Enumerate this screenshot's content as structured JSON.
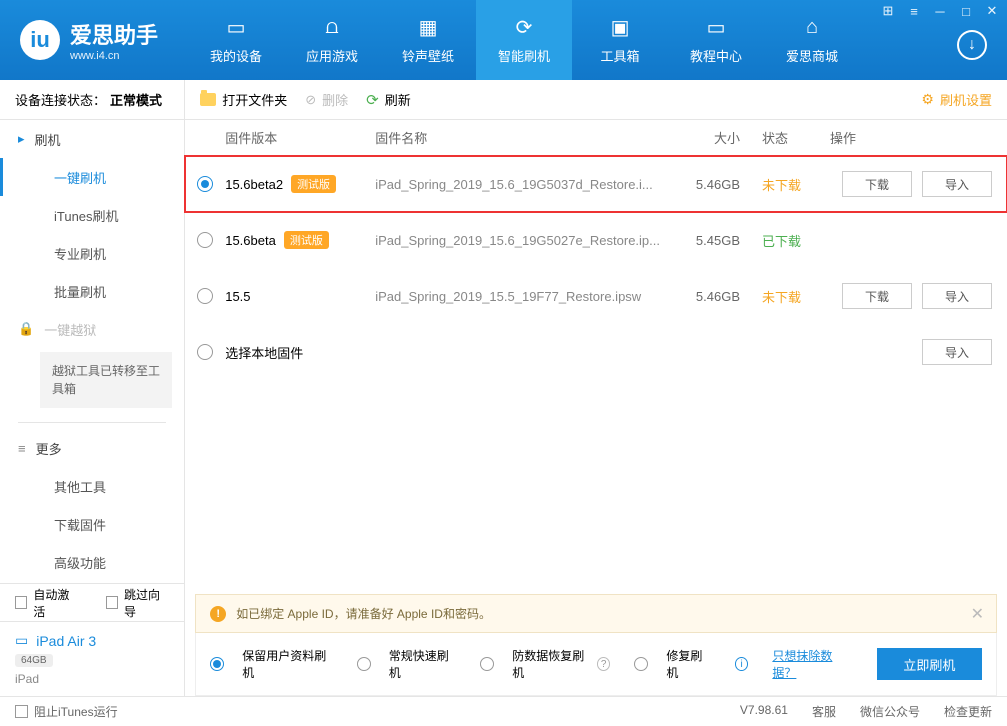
{
  "app": {
    "name": "爱思助手",
    "url": "www.i4.cn"
  },
  "nav": {
    "items": [
      {
        "label": "我的设备"
      },
      {
        "label": "应用游戏"
      },
      {
        "label": "铃声壁纸"
      },
      {
        "label": "智能刷机"
      },
      {
        "label": "工具箱"
      },
      {
        "label": "教程中心"
      },
      {
        "label": "爱思商城"
      }
    ]
  },
  "sidebar": {
    "status_label": "设备连接状态：",
    "status_value": "正常模式",
    "flash_header": "刷机",
    "items": [
      "一键刷机",
      "iTunes刷机",
      "专业刷机",
      "批量刷机"
    ],
    "jailbreak_header": "一键越狱",
    "jailbreak_note": "越狱工具已转移至工具箱",
    "more_header": "更多",
    "more_items": [
      "其他工具",
      "下载固件",
      "高级功能"
    ],
    "auto_activate": "自动激活",
    "skip_guide": "跳过向导",
    "device_name": "iPad Air 3",
    "device_capacity": "64GB",
    "device_type": "iPad"
  },
  "toolbar": {
    "open_folder": "打开文件夹",
    "delete": "删除",
    "refresh": "刷新",
    "settings": "刷机设置"
  },
  "table": {
    "headers": {
      "version": "固件版本",
      "name": "固件名称",
      "size": "大小",
      "status": "状态",
      "op": "操作"
    },
    "rows": [
      {
        "version": "15.6beta2",
        "beta": "测试版",
        "name": "iPad_Spring_2019_15.6_19G5037d_Restore.i...",
        "size": "5.46GB",
        "status": "未下载",
        "status_class": "pending",
        "selected": true,
        "highlighted": true,
        "download": "下载",
        "import": "导入"
      },
      {
        "version": "15.6beta",
        "beta": "测试版",
        "name": "iPad_Spring_2019_15.6_19G5027e_Restore.ip...",
        "size": "5.45GB",
        "status": "已下载",
        "status_class": "done"
      },
      {
        "version": "15.5",
        "name": "iPad_Spring_2019_15.5_19F77_Restore.ipsw",
        "size": "5.46GB",
        "status": "未下载",
        "status_class": "pending",
        "download": "下载",
        "import": "导入"
      },
      {
        "version": "选择本地固件",
        "local": true,
        "import": "导入"
      }
    ]
  },
  "alert": {
    "text": "如已绑定 Apple ID，请准备好 Apple ID和密码。"
  },
  "options": {
    "items": [
      "保留用户资料刷机",
      "常规快速刷机",
      "防数据恢复刷机",
      "修复刷机"
    ],
    "erase_link": "只想抹除数据？",
    "submit": "立即刷机"
  },
  "statusbar": {
    "block_itunes": "阻止iTunes运行",
    "version": "V7.98.61",
    "right": [
      "客服",
      "微信公众号",
      "检查更新"
    ]
  }
}
